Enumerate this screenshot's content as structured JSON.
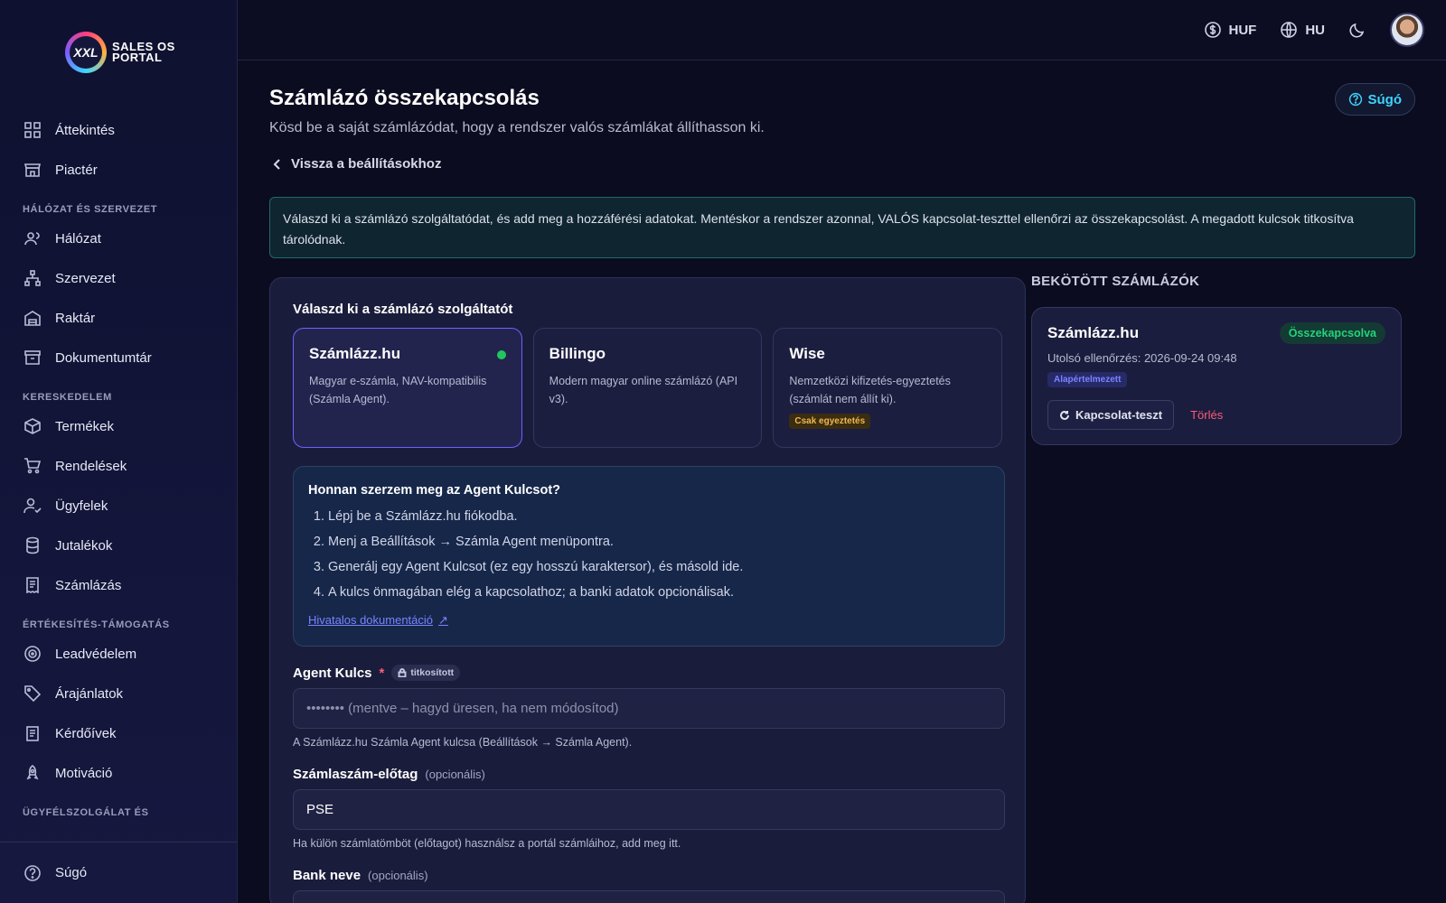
{
  "brand": {
    "logo_mark": "XXL",
    "logo_line1": "SALES OS",
    "logo_line2": "PORTAL"
  },
  "sidebar": {
    "items_top": [
      {
        "label": "Áttekintés",
        "icon": "grid-icon"
      },
      {
        "label": "Piactér",
        "icon": "store-icon"
      }
    ],
    "sections": [
      {
        "title": "HÁLÓZAT ÉS SZERVEZET",
        "items": [
          {
            "label": "Hálózat",
            "icon": "users-icon"
          },
          {
            "label": "Szervezet",
            "icon": "org-icon"
          },
          {
            "label": "Raktár",
            "icon": "warehouse-icon"
          },
          {
            "label": "Dokumentumtár",
            "icon": "archive-icon"
          }
        ]
      },
      {
        "title": "KERESKEDELEM",
        "items": [
          {
            "label": "Termékek",
            "icon": "box-icon"
          },
          {
            "label": "Rendelések",
            "icon": "cart-icon"
          },
          {
            "label": "Ügyfelek",
            "icon": "user-check-icon"
          },
          {
            "label": "Jutalékok",
            "icon": "database-icon"
          },
          {
            "label": "Számlázás",
            "icon": "receipt-icon"
          }
        ]
      },
      {
        "title": "ÉRTÉKESÍTÉS-TÁMOGATÁS",
        "items": [
          {
            "label": "Leadvédelem",
            "icon": "target-icon"
          },
          {
            "label": "Árajánlatok",
            "icon": "tag-icon"
          },
          {
            "label": "Kérdőívek",
            "icon": "clipboard-icon"
          },
          {
            "label": "Motiváció",
            "icon": "rocket-icon"
          }
        ]
      },
      {
        "title": "ÜGYFÉLSZOLGÁLAT ÉS",
        "items": []
      }
    ],
    "bottom": {
      "label": "Súgó",
      "icon": "help-icon"
    }
  },
  "topbar": {
    "currency": "HUF",
    "language": "HU",
    "theme_icon": "moon-icon"
  },
  "page": {
    "title": "Számlázó összekapcsolás",
    "subtitle": "Kösd be a saját számlázódat, hogy a rendszer valós számlákat állíthasson ki.",
    "help_label": "Súgó",
    "back_label": "Vissza a beállításokhoz",
    "info": "Válaszd ki a számlázó szolgáltatódat, és add meg a hozzáférési adatokat. Mentéskor a rendszer azonnal, VALÓS kapcsolat-teszttel ellenőrzi az összekapcsolást. A megadott kulcsok titkosítva tárolódnak."
  },
  "form": {
    "provider_label": "Válaszd ki a számlázó szolgáltatót",
    "providers": [
      {
        "name": "Számlázz.hu",
        "desc": "Magyar e-számla, NAV-kompatibilis (Számla Agent).",
        "selected": true,
        "badge": ""
      },
      {
        "name": "Billingo",
        "desc": "Modern magyar online számlázó (API v3).",
        "selected": false,
        "badge": ""
      },
      {
        "name": "Wise",
        "desc": "Nemzetközi kifizetés-egyeztetés (számlát nem állít ki).",
        "selected": false,
        "badge": "Csak egyeztetés"
      }
    ],
    "howto": {
      "title": "Honnan szerzem meg az Agent Kulcsot?",
      "steps": [
        "Lépj be a Számlázz.hu fiókodba.",
        "Menj a Beállítások → Számla Agent menüpontra.",
        "Generálj egy Agent Kulcsot (ez egy hosszú karaktersor), és másold ide.",
        "A kulcs önmagában elég a kapcsolathoz; a banki adatok opcionálisak."
      ],
      "link": "Hivatalos dokumentáció",
      "link_arrow": "↗"
    },
    "agent_key": {
      "label": "Agent Kulcs",
      "required_mark": "*",
      "encrypted_badge": "titkosított",
      "placeholder": "•••••••• (mentve – hagyd üresen, ha nem módosítod)",
      "hint": "A Számlázz.hu Számla Agent kulcsa (Beállítások → Számla Agent)."
    },
    "prefix": {
      "label": "Számlaszám-előtag",
      "optional": "(opcionális)",
      "value": "PSE",
      "hint": "Ha külön számlatömböt (előtagot) használsz a portál számláihoz, add meg itt."
    },
    "bank": {
      "label": "Bank neve",
      "optional": "(opcionális)",
      "value": ""
    }
  },
  "connected": {
    "title": "BEKÖTÖTT SZÁMLÁZÓK",
    "card": {
      "name": "Számlázz.hu",
      "status": "Összekapcsolva",
      "last_check": "Utolsó ellenőrzés: 2026-09-24 09:48",
      "default_badge": "Alapértelmezett",
      "test_label": "Kapcsolat-teszt",
      "delete_label": "Törlés"
    }
  }
}
